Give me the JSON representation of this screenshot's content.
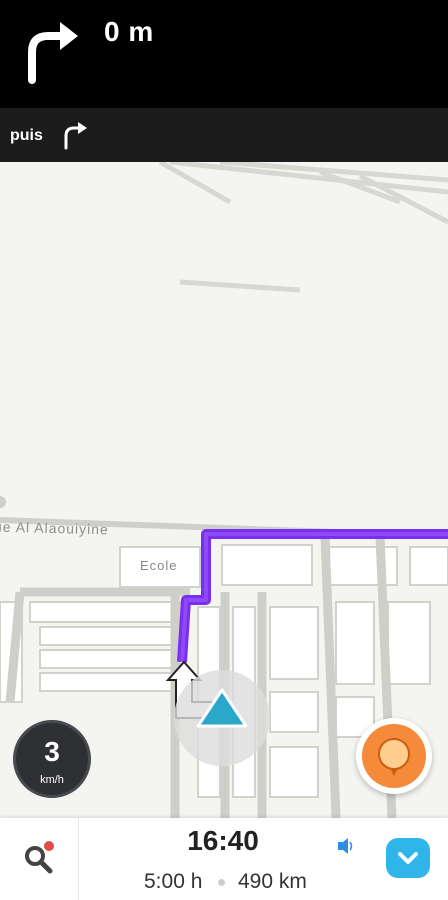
{
  "instruction": {
    "distance": "0 m",
    "turn_icon": "turn-right-arrow-icon",
    "then_label": "puis",
    "then_icon": "turn-right-arrow-icon"
  },
  "map": {
    "street_label": "ue Al Alaouiyine",
    "poi_label": "Ecole",
    "route_color": "#7a2ff0",
    "vehicle_color": "#2aa7c9"
  },
  "speedometer": {
    "value": "3",
    "unit": "km/h"
  },
  "report_button": {
    "icon": "report-pin-icon",
    "color": "#f58a3a"
  },
  "bottom_bar": {
    "search_icon": "search-icon",
    "arrival_time": "16:40",
    "duration": "5:00 h",
    "distance": "490 km",
    "sound_icon": "sound-icon",
    "menu_icon": "chevron-down-icon",
    "accent": "#2fb5ea"
  }
}
